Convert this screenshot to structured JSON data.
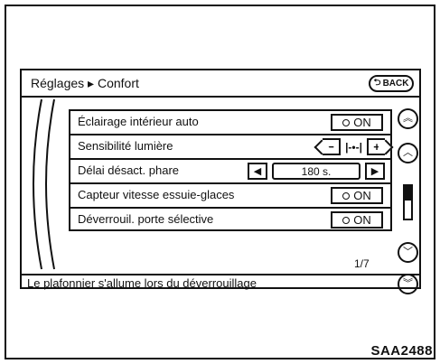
{
  "header": {
    "breadcrumb": "Réglages ▸ Confort",
    "back_label": "BACK"
  },
  "settings": [
    {
      "label": "Éclairage intérieur auto",
      "toggle": "ON"
    },
    {
      "label": "Sensibilité lumière",
      "level_display": "|-•-|",
      "minus": "−",
      "plus": "+"
    },
    {
      "label": "Délai désact. phare",
      "value": "180 s."
    },
    {
      "label": "Capteur vitesse essuie-glaces",
      "toggle": "ON"
    },
    {
      "label": "Déverrouil. porte sélective",
      "toggle": "ON"
    }
  ],
  "pagination": {
    "indicator": "1/7"
  },
  "scrollbar": {
    "page_up_icon": "double-chevron-up-icon",
    "up_icon": "chevron-up-icon",
    "down_icon": "chevron-down-icon",
    "page_down_icon": "double-chevron-down-icon",
    "position": 0
  },
  "status": {
    "text": "Le plafonnier s'allume lors du déverrouillage"
  },
  "figure_code": "SAA2488"
}
